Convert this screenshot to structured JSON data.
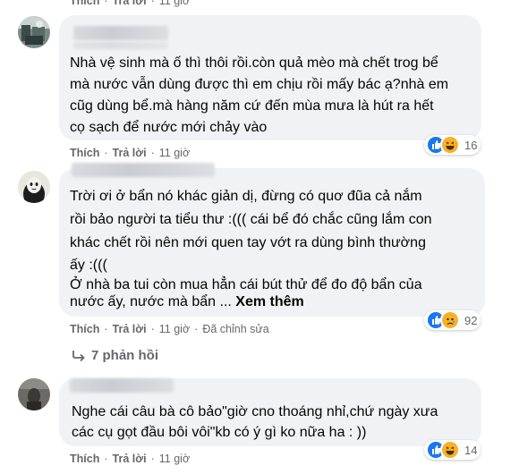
{
  "comments": [
    {
      "text_lines": [
        "Nhà vệ sinh mà ố thì thôi rồi.còn quả mèo mà chết trog bể",
        "mà nước vẫn dùng được thì em chịu rồi mấy bác ạ?nhà em",
        "cũg dùng bể.mà hàng năm cứ đến mùa mưa là hút ra hết",
        "cọ sạch để nước mới chảy vào"
      ],
      "like_label": "Thích",
      "reply_label": "Trả lời",
      "time": "11 giờ",
      "reaction_count": "16"
    },
    {
      "text_lines": [
        "Trời ơi ở bẩn nó khác giản dị, đừng có quơ đũa cả nắm",
        "rồi bảo người ta tiểu thư :((( cái bể đó chắc cũng lắm con",
        "khác chết rồi nên mới quen tay vớt ra dùng bình thường",
        "ấy :(((",
        "Ở nhà ba tui còn mua hẳn cái bút thử để đo độ bẩn của",
        "nước ấy, nước mà bẩn ..."
      ],
      "see_more": "Xem thêm",
      "like_label": "Thích",
      "reply_label": "Trả lời",
      "time": "11 giờ",
      "edited_label": "Đã chỉnh sửa",
      "reaction_count": "92",
      "replies_label": "7 phản hồi"
    },
    {
      "text_lines": [
        "Nghe cái câu bà cô bảo\"giờ cno thoáng nhỉ,chứ ngày xưa",
        "các cụ gọt đầu bôi vôi\"kb có ý gì ko nữa ha : ))"
      ],
      "like_label": "Thích",
      "reply_label": "Trả lời",
      "time": "11 giờ",
      "reaction_count": "14"
    }
  ],
  "top_partial": {
    "like_label": "Thích",
    "reply_label": "Trả lời",
    "time": "11 giờ"
  },
  "colors": {
    "bubble": "#f0f2f5",
    "meta": "#65676b",
    "like_blue": "#1877f2",
    "haha_yellow": "#f7b125",
    "sad_yellow": "#f7b125"
  }
}
